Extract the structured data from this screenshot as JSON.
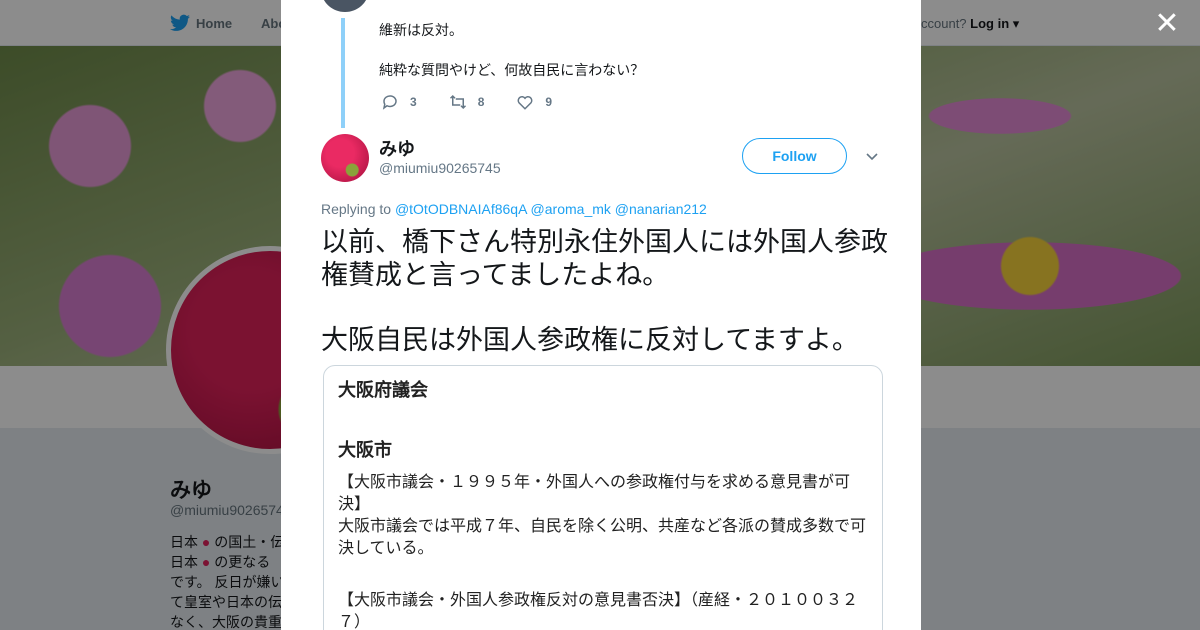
{
  "nav": {
    "home_label": "Home",
    "about_label": "Abo",
    "account_text": "ccount?",
    "login_label": "Log in"
  },
  "profile": {
    "name": "みゆ",
    "handle": "@miumiu9026574",
    "bio_lines": [
      "日本 ● の国土・伝",
      "日本 ● の更なる",
      "です。 反日が嫌い",
      "て皇室や日本の伝",
      "なく、大阪の貴重"
    ]
  },
  "previous_tweet": {
    "lines": [
      "維新は反対。",
      "純粋な質問やけど、何故自民に言わない？"
    ],
    "reply_count": "3",
    "retweet_count": "8",
    "like_count": "9"
  },
  "tweet": {
    "name": "みゆ",
    "handle": "@miumiu90265745",
    "follow_label": "Follow",
    "replying_prefix": "Replying to",
    "replying_to": [
      "@tOtODBNAIAf86qA",
      "@aroma_mk",
      "@nanarian212"
    ],
    "text_paragraphs": [
      "以前、橋下さん特別永住外国人には外国人参政権賛成と言ってましたよね。",
      "大阪自民は外国人参政権に反対してますよ。"
    ]
  },
  "media": {
    "heading1": "大阪府議会",
    "heading2": "大阪市",
    "para1": "【大阪市議会・１９９５年・外国人への参政権付与を求める意見書が可決】",
    "para2": "大阪市議会では平成７年、自民を除く公明、共産など各派の賛成多数で可決している。",
    "para3": "【大阪市議会・外国人参政権反対の意見書否決】（産経・２０１００３２７）"
  },
  "colors": {
    "link": "#1da1f2",
    "thread_line": "#8ed0f9",
    "text": "#14171a",
    "muted": "#657786"
  }
}
